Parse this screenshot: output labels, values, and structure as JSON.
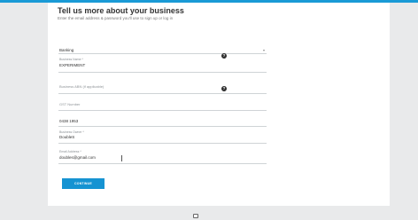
{
  "header": {
    "title": "Tell us more about your business",
    "subtitle": "Enter the email address & password you'll use to sign up or log in"
  },
  "form": {
    "business_type": {
      "value": "Banking"
    },
    "business_name": {
      "label": "Business Name *",
      "value": "EXPERIMENT"
    },
    "business_abn": {
      "placeholder": "Business ABN (if applicable)"
    },
    "gst_number": {
      "placeholder": "GST Number"
    },
    "phone": {
      "value": "0438 1953"
    },
    "business_owner": {
      "label": "Business Owner *",
      "value": "DoubleS"
    },
    "email": {
      "label": "Email Address *",
      "value": "doubles@gmail.com"
    },
    "continue_label": "CONTINUE"
  },
  "icons": {
    "help": "question-mark-circle-icon",
    "chat": "chat-icon"
  },
  "colors": {
    "accent": "#1693d2",
    "topbar": "#1a9ad6",
    "background": "#e9eaeb"
  }
}
